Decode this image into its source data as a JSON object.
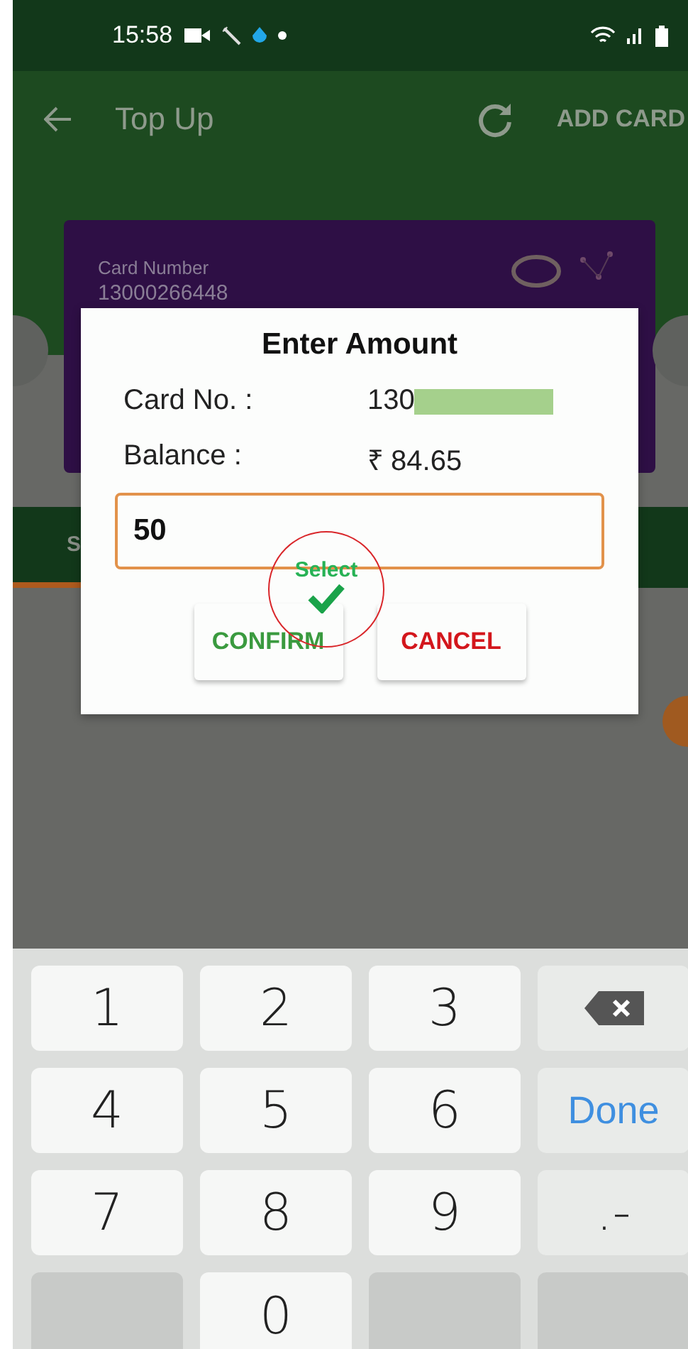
{
  "status_bar": {
    "time": "15:58"
  },
  "app_bar": {
    "title": "Top Up",
    "action": "ADD CARD"
  },
  "card": {
    "label": "Card Number",
    "number": "13000266448"
  },
  "tabs": [
    {
      "label": "S",
      "selected": true
    }
  ],
  "dialog": {
    "title": "Enter Amount",
    "rows": [
      {
        "label": "Card No. :",
        "value": "130",
        "redacted": true
      },
      {
        "label": "Balance :",
        "value": "₹ 84.65",
        "redacted": false
      }
    ],
    "amount": {
      "value": "50"
    },
    "buttons": [
      {
        "label": "CONFIRM",
        "kind": "confirm"
      },
      {
        "label": "CANCEL",
        "kind": "cancel"
      }
    ]
  },
  "annotation": {
    "label": "Select"
  },
  "keyboard": {
    "keys": [
      {
        "kind": "digit",
        "label": "1"
      },
      {
        "kind": "digit",
        "label": "2"
      },
      {
        "kind": "digit",
        "label": "3"
      },
      {
        "kind": "backspace"
      },
      {
        "kind": "digit",
        "label": "4"
      },
      {
        "kind": "digit",
        "label": "5"
      },
      {
        "kind": "digit",
        "label": "6"
      },
      {
        "kind": "action",
        "label": "Done"
      },
      {
        "kind": "digit",
        "label": "7"
      },
      {
        "kind": "digit",
        "label": "8"
      },
      {
        "kind": "digit",
        "label": "9"
      },
      {
        "kind": "symbol",
        "label": ".-"
      },
      {
        "kind": "blank"
      },
      {
        "kind": "digit",
        "label": "0"
      },
      {
        "kind": "blank"
      },
      {
        "kind": "blank"
      }
    ]
  }
}
